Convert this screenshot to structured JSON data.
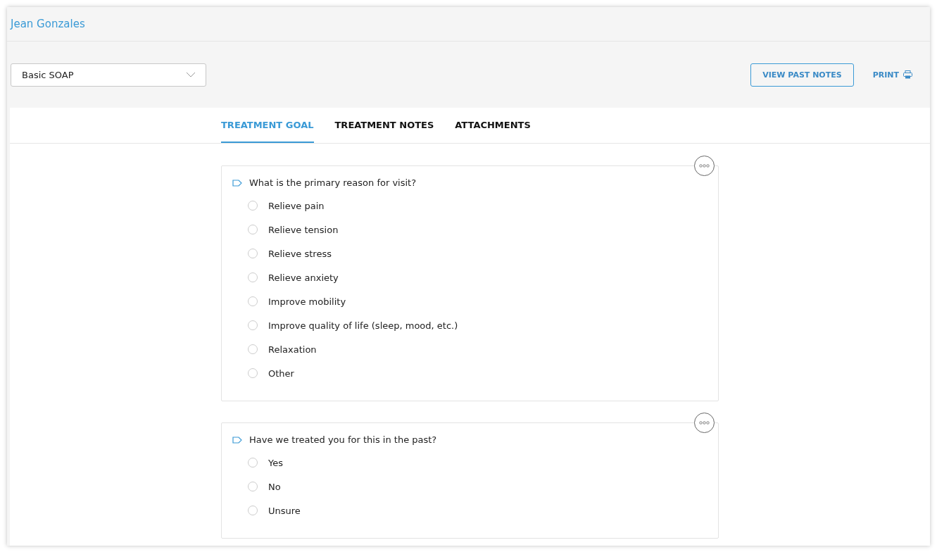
{
  "patient": {
    "name": "Jean Gonzales"
  },
  "template_select": {
    "value": "Basic SOAP"
  },
  "actions": {
    "view_past_notes": "VIEW PAST NOTES",
    "print": "PRINT"
  },
  "tabs": [
    {
      "label": "TREATMENT GOAL",
      "selected": true
    },
    {
      "label": "TREATMENT NOTES",
      "selected": false
    },
    {
      "label": "ATTACHMENTS",
      "selected": false
    }
  ],
  "questions": [
    {
      "text": "What is the primary reason for visit?",
      "options": [
        {
          "label": "Relieve pain",
          "selected": false
        },
        {
          "label": "Relieve tension",
          "selected": false
        },
        {
          "label": "Relieve stress",
          "selected": false
        },
        {
          "label": "Relieve anxiety",
          "selected": false
        },
        {
          "label": "Improve mobility",
          "selected": false
        },
        {
          "label": "Improve quality of life (sleep, mood, etc.)",
          "selected": false
        },
        {
          "label": "Relaxation",
          "selected": false
        },
        {
          "label": "Other",
          "selected": false
        }
      ]
    },
    {
      "text": "Have we treated you for this in the past?",
      "options": [
        {
          "label": "Yes",
          "selected": false
        },
        {
          "label": "No",
          "selected": false
        },
        {
          "label": "Unsure",
          "selected": false
        }
      ]
    }
  ]
}
